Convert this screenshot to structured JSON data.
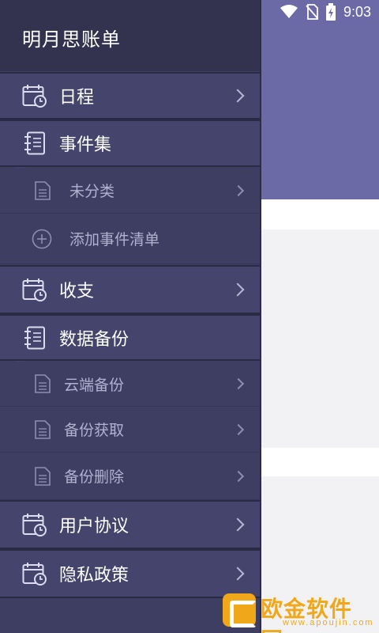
{
  "status_bar": {
    "time": "9:03"
  },
  "app": {
    "title": "明月思账单"
  },
  "menu": {
    "schedule": "日程",
    "events": "事件集",
    "uncategorized": "未分类",
    "add_event_list": "添加事件清单",
    "income_expense": "收支",
    "data_backup": "数据备份",
    "cloud_backup": "云端备份",
    "backup_fetch": "备份获取",
    "backup_delete": "备份删除",
    "user_agreement": "用户协议",
    "privacy_policy": "隐私政策"
  },
  "watermark": {
    "text": "欧金软件园",
    "url": "www.apoujin.com"
  },
  "colors": {
    "drawer_bg": "#3e3d62",
    "drawer_item": "#45446c",
    "header_bg": "#34334f",
    "app_bar": "#6c6aa6",
    "watermark": "#f0a81a"
  }
}
